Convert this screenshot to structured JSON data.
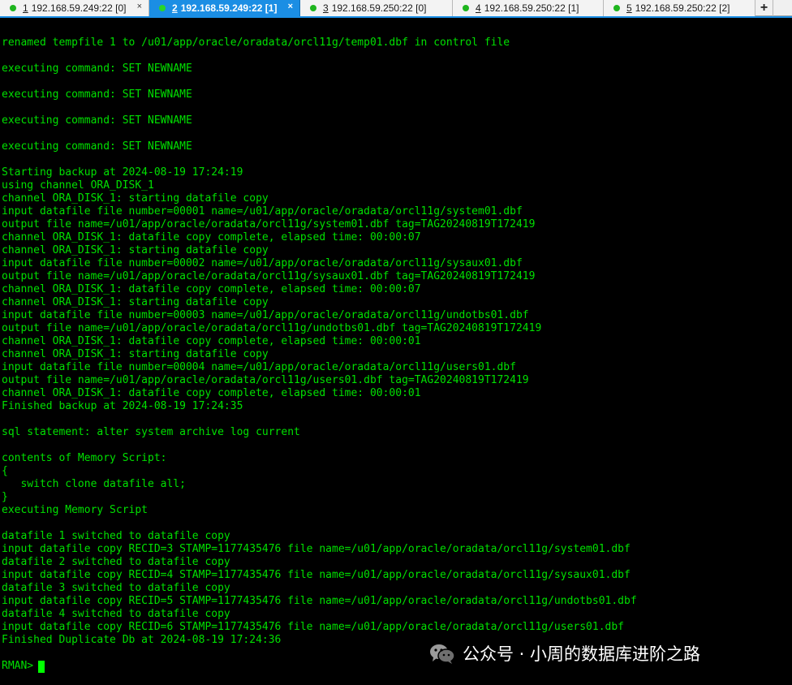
{
  "tabs": [
    {
      "num": "1",
      "label": "192.168.59.249:22 [0]",
      "active": false
    },
    {
      "num": "2",
      "label": "192.168.59.249:22 [1]",
      "active": true
    },
    {
      "num": "3",
      "label": "192.168.59.250:22 [0]",
      "active": false
    },
    {
      "num": "4",
      "label": "192.168.59.250:22 [1]",
      "active": false
    },
    {
      "num": "5",
      "label": "192.168.59.250:22 [2]",
      "active": false
    }
  ],
  "icons": {
    "close": "×",
    "new_tab": "+"
  },
  "colors": {
    "terminal_bg": "#000000",
    "terminal_text": "#00e000",
    "active_tab": "#1b8ee4",
    "status_dot": "#1eb51e"
  },
  "terminal": {
    "lines": [
      "renamed tempfile 1 to /u01/app/oracle/oradata/orcl11g/temp01.dbf in control file",
      "",
      "executing command: SET NEWNAME",
      "",
      "executing command: SET NEWNAME",
      "",
      "executing command: SET NEWNAME",
      "",
      "executing command: SET NEWNAME",
      "",
      "Starting backup at 2024-08-19 17:24:19",
      "using channel ORA_DISK_1",
      "channel ORA_DISK_1: starting datafile copy",
      "input datafile file number=00001 name=/u01/app/oracle/oradata/orcl11g/system01.dbf",
      "output file name=/u01/app/oracle/oradata/orcl11g/system01.dbf tag=TAG20240819T172419",
      "channel ORA_DISK_1: datafile copy complete, elapsed time: 00:00:07",
      "channel ORA_DISK_1: starting datafile copy",
      "input datafile file number=00002 name=/u01/app/oracle/oradata/orcl11g/sysaux01.dbf",
      "output file name=/u01/app/oracle/oradata/orcl11g/sysaux01.dbf tag=TAG20240819T172419",
      "channel ORA_DISK_1: datafile copy complete, elapsed time: 00:00:07",
      "channel ORA_DISK_1: starting datafile copy",
      "input datafile file number=00003 name=/u01/app/oracle/oradata/orcl11g/undotbs01.dbf",
      "output file name=/u01/app/oracle/oradata/orcl11g/undotbs01.dbf tag=TAG20240819T172419",
      "channel ORA_DISK_1: datafile copy complete, elapsed time: 00:00:01",
      "channel ORA_DISK_1: starting datafile copy",
      "input datafile file number=00004 name=/u01/app/oracle/oradata/orcl11g/users01.dbf",
      "output file name=/u01/app/oracle/oradata/orcl11g/users01.dbf tag=TAG20240819T172419",
      "channel ORA_DISK_1: datafile copy complete, elapsed time: 00:00:01",
      "Finished backup at 2024-08-19 17:24:35",
      "",
      "sql statement: alter system archive log current",
      "",
      "contents of Memory Script:",
      "{",
      "   switch clone datafile all;",
      "}",
      "executing Memory Script",
      "",
      "datafile 1 switched to datafile copy",
      "input datafile copy RECID=3 STAMP=1177435476 file name=/u01/app/oracle/oradata/orcl11g/system01.dbf",
      "datafile 2 switched to datafile copy",
      "input datafile copy RECID=4 STAMP=1177435476 file name=/u01/app/oracle/oradata/orcl11g/sysaux01.dbf",
      "datafile 3 switched to datafile copy",
      "input datafile copy RECID=5 STAMP=1177435476 file name=/u01/app/oracle/oradata/orcl11g/undotbs01.dbf",
      "datafile 4 switched to datafile copy",
      "input datafile copy RECID=6 STAMP=1177435476 file name=/u01/app/oracle/oradata/orcl11g/users01.dbf",
      "Finished Duplicate Db at 2024-08-19 17:24:36",
      ""
    ],
    "prompt": "RMAN>"
  },
  "watermark": {
    "text": "公众号 · 小周的数据库进阶之路"
  }
}
